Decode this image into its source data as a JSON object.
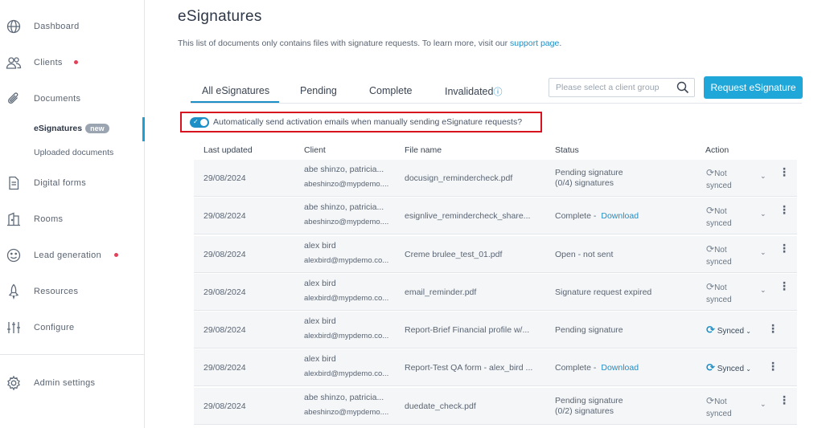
{
  "sidebar": {
    "items": [
      {
        "label": "Dashboard",
        "icon": "globe-icon"
      },
      {
        "label": "Clients",
        "icon": "users-icon",
        "dot": true
      },
      {
        "label": "Documents",
        "icon": "paperclip-icon"
      },
      {
        "label": "Digital forms",
        "icon": "form-icon"
      },
      {
        "label": "Rooms",
        "icon": "rooms-icon"
      },
      {
        "label": "Lead generation",
        "icon": "smiley-icon",
        "dot": true
      },
      {
        "label": "Resources",
        "icon": "rocket-icon"
      },
      {
        "label": "Configure",
        "icon": "sliders-icon"
      },
      {
        "label": "Admin settings",
        "icon": "gear-icon"
      }
    ],
    "subitems": [
      {
        "label": "eSignatures",
        "badge": "new"
      },
      {
        "label": "Uploaded documents"
      }
    ]
  },
  "page": {
    "title": "eSignatures",
    "subtitle": "This list of documents only contains files with signature requests. To learn more, visit our",
    "support_link": "support page",
    "subtitle_end": "."
  },
  "tabs": [
    "All eSignatures",
    "Pending",
    "Complete",
    "Invalidated"
  ],
  "search": {
    "placeholder": "Please select a client group"
  },
  "request_button": "Request eSignature",
  "auto_toggle": {
    "label": "Automatically send activation emails when manually sending eSignature requests?",
    "on": true
  },
  "table": {
    "headers": [
      "Last updated",
      "Client",
      "File name",
      "Status",
      "Action"
    ],
    "rows": [
      {
        "date": "29/08/2024",
        "client": "abe shinzo, patricia...",
        "email": "abeshinzo@mypdemo....",
        "file": "docusign_remindercheck.pdf",
        "status": "Pending signature",
        "status2": "(0/4) signatures",
        "link": "",
        "synced": false
      },
      {
        "date": "29/08/2024",
        "client": "abe shinzo, patricia...",
        "email": "abeshinzo@mypdemo....",
        "file": "esignlive_remindercheck_share...",
        "status": "Complete -",
        "status2": "",
        "link": "Download",
        "synced": false
      },
      {
        "date": "29/08/2024",
        "client": "alex bird",
        "email": "alexbird@mypdemo.co...",
        "file": "Creme brulee_test_01.pdf",
        "status": "Open - not sent",
        "status2": "",
        "link": "",
        "synced": false
      },
      {
        "date": "29/08/2024",
        "client": "alex bird",
        "email": "alexbird@mypdemo.co...",
        "file": "email_reminder.pdf",
        "status": "Signature request expired",
        "status2": "",
        "link": "",
        "synced": false
      },
      {
        "date": "29/08/2024",
        "client": "alex bird",
        "email": "alexbird@mypdemo.co...",
        "file": "Report-Brief Financial profile w/...",
        "status": "Pending signature",
        "status2": "",
        "link": "",
        "synced": true
      },
      {
        "date": "29/08/2024",
        "client": "alex bird",
        "email": "alexbird@mypdemo.co...",
        "file": "Report-Test QA form - alex_bird ...",
        "status": "Complete -",
        "status2": "",
        "link": "Download",
        "synced": true
      },
      {
        "date": "29/08/2024",
        "client": "abe shinzo, patricia...",
        "email": "abeshinzo@mypdemo....",
        "file": "duedate_check.pdf",
        "status": "Pending signature",
        "status2": "(0/2) signatures",
        "link": "",
        "synced": false
      }
    ],
    "not_synced_line1": "Not",
    "not_synced_line2": "synced",
    "synced_label": "Synced"
  },
  "colors": {
    "accent": "#1c8fc6",
    "button": "#1ea7d8",
    "highlight": "#d9121f",
    "dot": "#e0425a"
  }
}
